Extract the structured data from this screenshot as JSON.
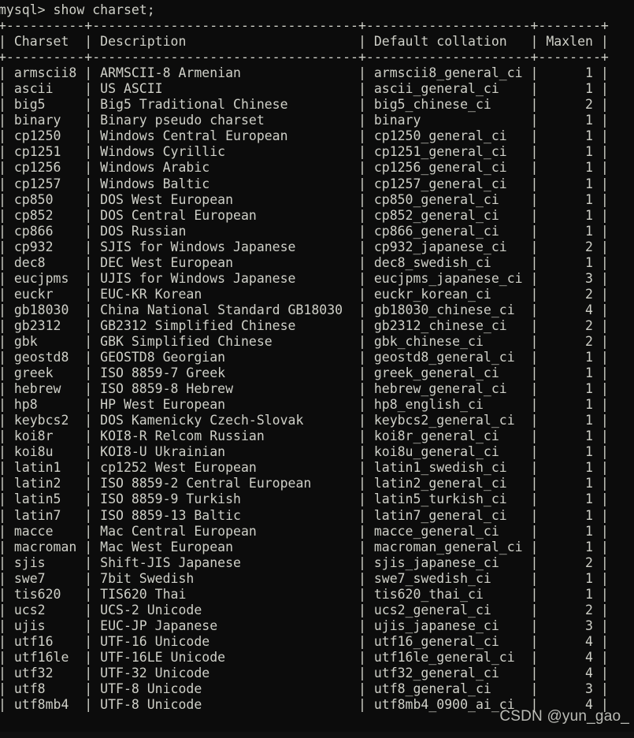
{
  "terminal": {
    "prompt": "mysql> ",
    "command": "show charset;",
    "background_color": "#0c0c0c",
    "text_color": "#cfd0c8"
  },
  "table": {
    "columns": [
      {
        "header": "Charset",
        "width": 10,
        "align": "left"
      },
      {
        "header": "Description",
        "width": 34,
        "align": "left"
      },
      {
        "header": "Default collation",
        "width": 21,
        "align": "left"
      },
      {
        "header": "Maxlen",
        "width": 8,
        "align": "right"
      }
    ],
    "rows": [
      {
        "charset": "armscii8",
        "description": "ARMSCII-8 Armenian",
        "collation": "armscii8_general_ci",
        "maxlen": "1"
      },
      {
        "charset": "ascii",
        "description": "US ASCII",
        "collation": "ascii_general_ci",
        "maxlen": "1"
      },
      {
        "charset": "big5",
        "description": "Big5 Traditional Chinese",
        "collation": "big5_chinese_ci",
        "maxlen": "2"
      },
      {
        "charset": "binary",
        "description": "Binary pseudo charset",
        "collation": "binary",
        "maxlen": "1"
      },
      {
        "charset": "cp1250",
        "description": "Windows Central European",
        "collation": "cp1250_general_ci",
        "maxlen": "1"
      },
      {
        "charset": "cp1251",
        "description": "Windows Cyrillic",
        "collation": "cp1251_general_ci",
        "maxlen": "1"
      },
      {
        "charset": "cp1256",
        "description": "Windows Arabic",
        "collation": "cp1256_general_ci",
        "maxlen": "1"
      },
      {
        "charset": "cp1257",
        "description": "Windows Baltic",
        "collation": "cp1257_general_ci",
        "maxlen": "1"
      },
      {
        "charset": "cp850",
        "description": "DOS West European",
        "collation": "cp850_general_ci",
        "maxlen": "1"
      },
      {
        "charset": "cp852",
        "description": "DOS Central European",
        "collation": "cp852_general_ci",
        "maxlen": "1"
      },
      {
        "charset": "cp866",
        "description": "DOS Russian",
        "collation": "cp866_general_ci",
        "maxlen": "1"
      },
      {
        "charset": "cp932",
        "description": "SJIS for Windows Japanese",
        "collation": "cp932_japanese_ci",
        "maxlen": "2"
      },
      {
        "charset": "dec8",
        "description": "DEC West European",
        "collation": "dec8_swedish_ci",
        "maxlen": "1"
      },
      {
        "charset": "eucjpms",
        "description": "UJIS for Windows Japanese",
        "collation": "eucjpms_japanese_ci",
        "maxlen": "3"
      },
      {
        "charset": "euckr",
        "description": "EUC-KR Korean",
        "collation": "euckr_korean_ci",
        "maxlen": "2"
      },
      {
        "charset": "gb18030",
        "description": "China National Standard GB18030",
        "collation": "gb18030_chinese_ci",
        "maxlen": "4"
      },
      {
        "charset": "gb2312",
        "description": "GB2312 Simplified Chinese",
        "collation": "gb2312_chinese_ci",
        "maxlen": "2"
      },
      {
        "charset": "gbk",
        "description": "GBK Simplified Chinese",
        "collation": "gbk_chinese_ci",
        "maxlen": "2"
      },
      {
        "charset": "geostd8",
        "description": "GEOSTD8 Georgian",
        "collation": "geostd8_general_ci",
        "maxlen": "1"
      },
      {
        "charset": "greek",
        "description": "ISO 8859-7 Greek",
        "collation": "greek_general_ci",
        "maxlen": "1"
      },
      {
        "charset": "hebrew",
        "description": "ISO 8859-8 Hebrew",
        "collation": "hebrew_general_ci",
        "maxlen": "1"
      },
      {
        "charset": "hp8",
        "description": "HP West European",
        "collation": "hp8_english_ci",
        "maxlen": "1"
      },
      {
        "charset": "keybcs2",
        "description": "DOS Kamenicky Czech-Slovak",
        "collation": "keybcs2_general_ci",
        "maxlen": "1"
      },
      {
        "charset": "koi8r",
        "description": "KOI8-R Relcom Russian",
        "collation": "koi8r_general_ci",
        "maxlen": "1"
      },
      {
        "charset": "koi8u",
        "description": "KOI8-U Ukrainian",
        "collation": "koi8u_general_ci",
        "maxlen": "1"
      },
      {
        "charset": "latin1",
        "description": "cp1252 West European",
        "collation": "latin1_swedish_ci",
        "maxlen": "1"
      },
      {
        "charset": "latin2",
        "description": "ISO 8859-2 Central European",
        "collation": "latin2_general_ci",
        "maxlen": "1"
      },
      {
        "charset": "latin5",
        "description": "ISO 8859-9 Turkish",
        "collation": "latin5_turkish_ci",
        "maxlen": "1"
      },
      {
        "charset": "latin7",
        "description": "ISO 8859-13 Baltic",
        "collation": "latin7_general_ci",
        "maxlen": "1"
      },
      {
        "charset": "macce",
        "description": "Mac Central European",
        "collation": "macce_general_ci",
        "maxlen": "1"
      },
      {
        "charset": "macroman",
        "description": "Mac West European",
        "collation": "macroman_general_ci",
        "maxlen": "1"
      },
      {
        "charset": "sjis",
        "description": "Shift-JIS Japanese",
        "collation": "sjis_japanese_ci",
        "maxlen": "2"
      },
      {
        "charset": "swe7",
        "description": "7bit Swedish",
        "collation": "swe7_swedish_ci",
        "maxlen": "1"
      },
      {
        "charset": "tis620",
        "description": "TIS620 Thai",
        "collation": "tis620_thai_ci",
        "maxlen": "1"
      },
      {
        "charset": "ucs2",
        "description": "UCS-2 Unicode",
        "collation": "ucs2_general_ci",
        "maxlen": "2"
      },
      {
        "charset": "ujis",
        "description": "EUC-JP Japanese",
        "collation": "ujis_japanese_ci",
        "maxlen": "3"
      },
      {
        "charset": "utf16",
        "description": "UTF-16 Unicode",
        "collation": "utf16_general_ci",
        "maxlen": "4"
      },
      {
        "charset": "utf16le",
        "description": "UTF-16LE Unicode",
        "collation": "utf16le_general_ci",
        "maxlen": "4"
      },
      {
        "charset": "utf32",
        "description": "UTF-32 Unicode",
        "collation": "utf32_general_ci",
        "maxlen": "4"
      },
      {
        "charset": "utf8",
        "description": "UTF-8 Unicode",
        "collation": "utf8_general_ci",
        "maxlen": "3"
      },
      {
        "charset": "utf8mb4",
        "description": "UTF-8 Unicode",
        "collation": "utf8mb4_0900_ai_ci",
        "maxlen": "4"
      }
    ]
  },
  "watermark": {
    "text": "CSDN @yun_gao_"
  }
}
